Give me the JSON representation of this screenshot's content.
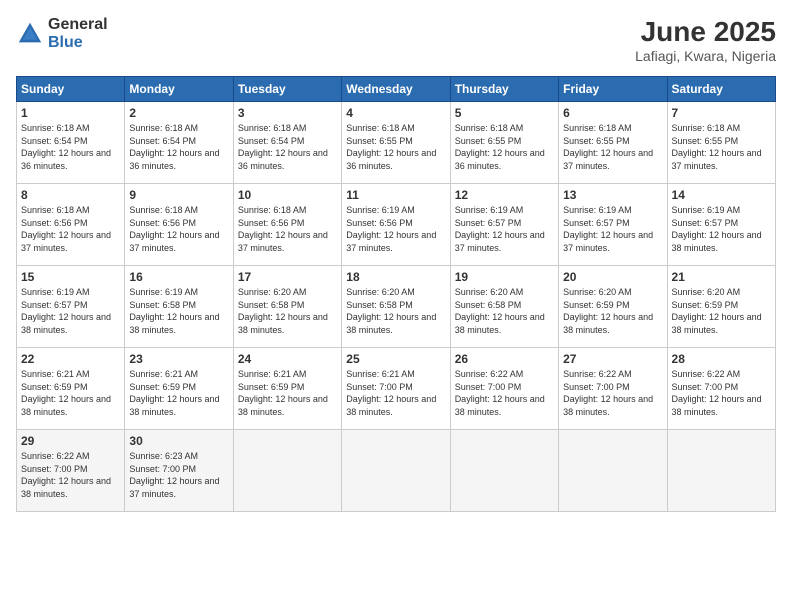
{
  "header": {
    "logo_general": "General",
    "logo_blue": "Blue",
    "title": "June 2025",
    "location": "Lafiagi, Kwara, Nigeria"
  },
  "calendar": {
    "days_of_week": [
      "Sunday",
      "Monday",
      "Tuesday",
      "Wednesday",
      "Thursday",
      "Friday",
      "Saturday"
    ],
    "weeks": [
      [
        {
          "day": "1",
          "sunrise": "6:18 AM",
          "sunset": "6:54 PM",
          "daylight": "12 hours and 36 minutes."
        },
        {
          "day": "2",
          "sunrise": "6:18 AM",
          "sunset": "6:54 PM",
          "daylight": "12 hours and 36 minutes."
        },
        {
          "day": "3",
          "sunrise": "6:18 AM",
          "sunset": "6:54 PM",
          "daylight": "12 hours and 36 minutes."
        },
        {
          "day": "4",
          "sunrise": "6:18 AM",
          "sunset": "6:55 PM",
          "daylight": "12 hours and 36 minutes."
        },
        {
          "day": "5",
          "sunrise": "6:18 AM",
          "sunset": "6:55 PM",
          "daylight": "12 hours and 36 minutes."
        },
        {
          "day": "6",
          "sunrise": "6:18 AM",
          "sunset": "6:55 PM",
          "daylight": "12 hours and 37 minutes."
        },
        {
          "day": "7",
          "sunrise": "6:18 AM",
          "sunset": "6:55 PM",
          "daylight": "12 hours and 37 minutes."
        }
      ],
      [
        {
          "day": "8",
          "sunrise": "6:18 AM",
          "sunset": "6:56 PM",
          "daylight": "12 hours and 37 minutes."
        },
        {
          "day": "9",
          "sunrise": "6:18 AM",
          "sunset": "6:56 PM",
          "daylight": "12 hours and 37 minutes."
        },
        {
          "day": "10",
          "sunrise": "6:18 AM",
          "sunset": "6:56 PM",
          "daylight": "12 hours and 37 minutes."
        },
        {
          "day": "11",
          "sunrise": "6:19 AM",
          "sunset": "6:56 PM",
          "daylight": "12 hours and 37 minutes."
        },
        {
          "day": "12",
          "sunrise": "6:19 AM",
          "sunset": "6:57 PM",
          "daylight": "12 hours and 37 minutes."
        },
        {
          "day": "13",
          "sunrise": "6:19 AM",
          "sunset": "6:57 PM",
          "daylight": "12 hours and 37 minutes."
        },
        {
          "day": "14",
          "sunrise": "6:19 AM",
          "sunset": "6:57 PM",
          "daylight": "12 hours and 38 minutes."
        }
      ],
      [
        {
          "day": "15",
          "sunrise": "6:19 AM",
          "sunset": "6:57 PM",
          "daylight": "12 hours and 38 minutes."
        },
        {
          "day": "16",
          "sunrise": "6:19 AM",
          "sunset": "6:58 PM",
          "daylight": "12 hours and 38 minutes."
        },
        {
          "day": "17",
          "sunrise": "6:20 AM",
          "sunset": "6:58 PM",
          "daylight": "12 hours and 38 minutes."
        },
        {
          "day": "18",
          "sunrise": "6:20 AM",
          "sunset": "6:58 PM",
          "daylight": "12 hours and 38 minutes."
        },
        {
          "day": "19",
          "sunrise": "6:20 AM",
          "sunset": "6:58 PM",
          "daylight": "12 hours and 38 minutes."
        },
        {
          "day": "20",
          "sunrise": "6:20 AM",
          "sunset": "6:59 PM",
          "daylight": "12 hours and 38 minutes."
        },
        {
          "day": "21",
          "sunrise": "6:20 AM",
          "sunset": "6:59 PM",
          "daylight": "12 hours and 38 minutes."
        }
      ],
      [
        {
          "day": "22",
          "sunrise": "6:21 AM",
          "sunset": "6:59 PM",
          "daylight": "12 hours and 38 minutes."
        },
        {
          "day": "23",
          "sunrise": "6:21 AM",
          "sunset": "6:59 PM",
          "daylight": "12 hours and 38 minutes."
        },
        {
          "day": "24",
          "sunrise": "6:21 AM",
          "sunset": "6:59 PM",
          "daylight": "12 hours and 38 minutes."
        },
        {
          "day": "25",
          "sunrise": "6:21 AM",
          "sunset": "7:00 PM",
          "daylight": "12 hours and 38 minutes."
        },
        {
          "day": "26",
          "sunrise": "6:22 AM",
          "sunset": "7:00 PM",
          "daylight": "12 hours and 38 minutes."
        },
        {
          "day": "27",
          "sunrise": "6:22 AM",
          "sunset": "7:00 PM",
          "daylight": "12 hours and 38 minutes."
        },
        {
          "day": "28",
          "sunrise": "6:22 AM",
          "sunset": "7:00 PM",
          "daylight": "12 hours and 38 minutes."
        }
      ],
      [
        {
          "day": "29",
          "sunrise": "6:22 AM",
          "sunset": "7:00 PM",
          "daylight": "12 hours and 38 minutes."
        },
        {
          "day": "30",
          "sunrise": "6:23 AM",
          "sunset": "7:00 PM",
          "daylight": "12 hours and 37 minutes."
        },
        null,
        null,
        null,
        null,
        null
      ]
    ]
  }
}
